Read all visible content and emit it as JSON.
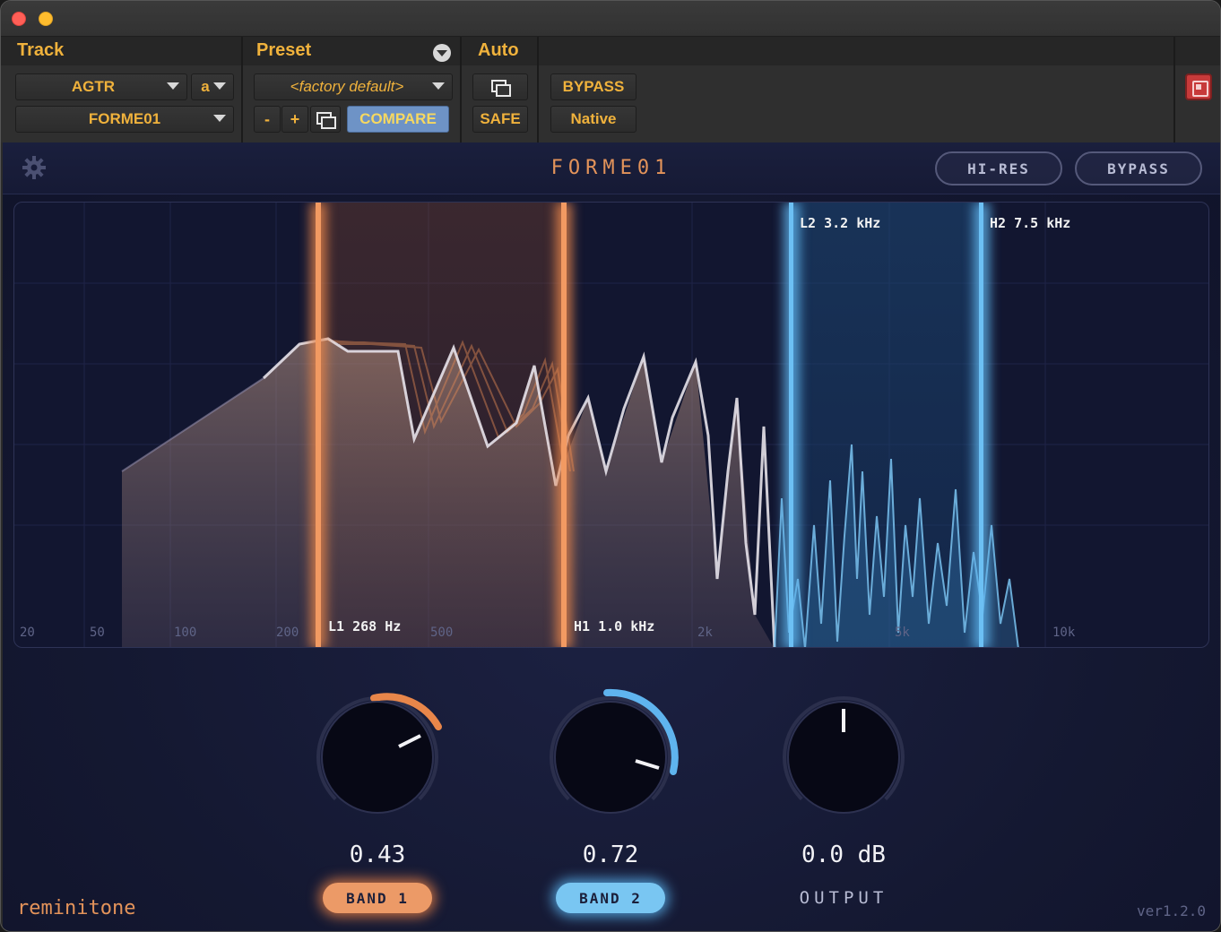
{
  "header": {
    "track_label": "Track",
    "preset_label": "Preset",
    "auto_label": "Auto",
    "track_name": "AGTR",
    "track_channel": "a",
    "plugin_name": "FORME01",
    "preset_name": "<factory default>",
    "minus_label": "-",
    "plus_label": "+",
    "compare_label": "COMPARE",
    "safe_label": "SAFE",
    "bypass_label": "BYPASS",
    "native_label": "Native"
  },
  "plugin": {
    "title": "FORME01",
    "hires_label": "HI-RES",
    "bypass_label": "BYPASS",
    "brand": "reminitone",
    "version": "ver1.2.0"
  },
  "analyzer": {
    "bands": [
      {
        "label": "L1 268 Hz",
        "color": "#e8864a"
      },
      {
        "label": "H1 1.0 kHz",
        "color": "#e8864a"
      },
      {
        "label": "L2 3.2 kHz",
        "color": "#5fb4ee"
      },
      {
        "label": "H2 7.5 kHz",
        "color": "#5fb4ee"
      }
    ],
    "freq_labels": [
      "20",
      "50",
      "100",
      "200",
      "500",
      "2k",
      "5k",
      "10k"
    ]
  },
  "knobs": {
    "band1": {
      "value": "0.43",
      "label": "BAND 1",
      "color": "#e8864a"
    },
    "band2": {
      "value": "0.72",
      "label": "BAND 2",
      "color": "#5fb4ee"
    },
    "output": {
      "value": "0.0 dB",
      "label": "OUTPUT"
    }
  },
  "icons": [
    "gear-icon",
    "copy-icon",
    "power-icon",
    "chevron-down-icon"
  ]
}
